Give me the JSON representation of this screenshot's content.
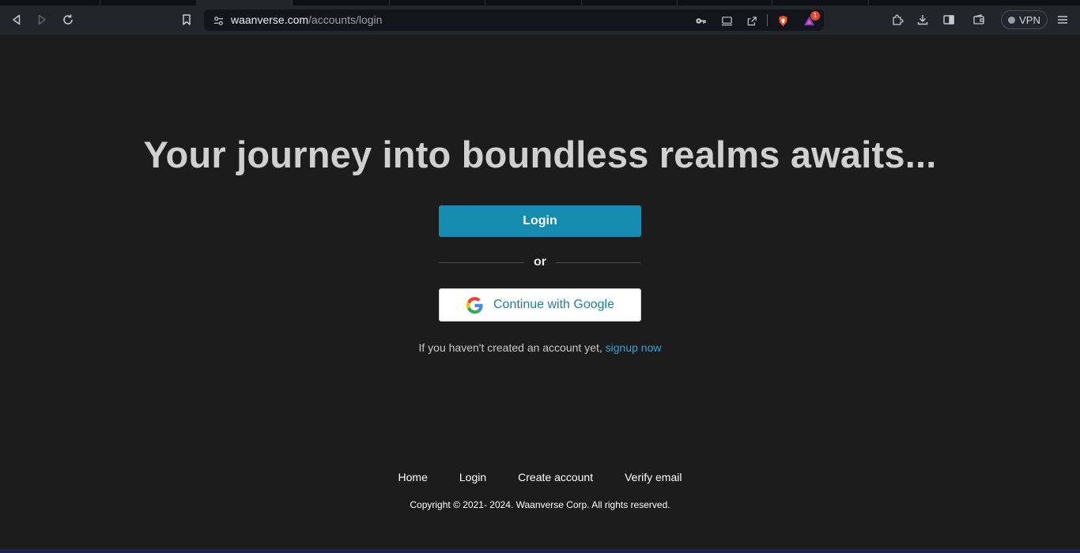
{
  "browser": {
    "url_host": "waanverse.com",
    "url_path": "/accounts/login",
    "vpn_label": "VPN",
    "notification_count": "1",
    "brand_color": "#fb542b"
  },
  "page": {
    "title": "Your journey into boundless realms awaits...",
    "login_label": "Login",
    "or_label": "or",
    "google_label": "Continue with Google",
    "signup_prefix": "If you haven't created an account yet, ",
    "signup_link": "signup now",
    "accent_color": "#168cb1"
  },
  "footer": {
    "links": [
      "Home",
      "Login",
      "Create account",
      "Verify email"
    ],
    "copyright": "Copyright © 2021- 2024. Waanverse Corp. All rights reserved."
  }
}
